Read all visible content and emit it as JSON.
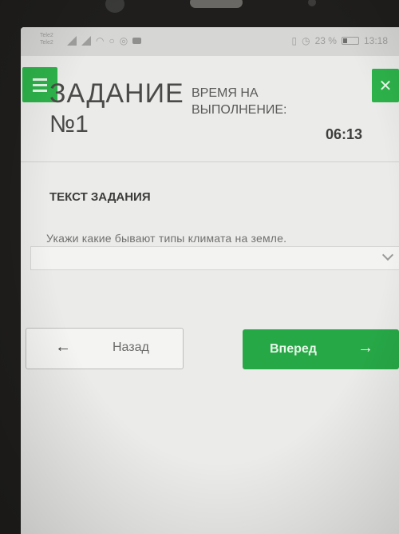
{
  "status_bar": {
    "sim_lines": [
      "Tele2",
      "Tele2"
    ],
    "battery_percent": "23 %",
    "time": "13:18"
  },
  "header": {
    "menu_icon": "menu-icon",
    "close_icon": "close-icon",
    "task_title": "ЗАДАНИЕ",
    "task_number": "№1",
    "time_label": "ВРЕМЯ НА ВЫПОЛНЕНИЕ:",
    "time_value": "06:13"
  },
  "task": {
    "heading": "ТЕКСТ ЗАДАНИЯ",
    "question": "Укажи какие бывают типы климата на земле.",
    "answer_value": ""
  },
  "nav": {
    "back_label": "Назад",
    "next_label": "Вперед",
    "back_arrow": "←",
    "next_arrow": "→"
  },
  "colors": {
    "accent": "#2db24a",
    "background": "#ebebe9"
  }
}
